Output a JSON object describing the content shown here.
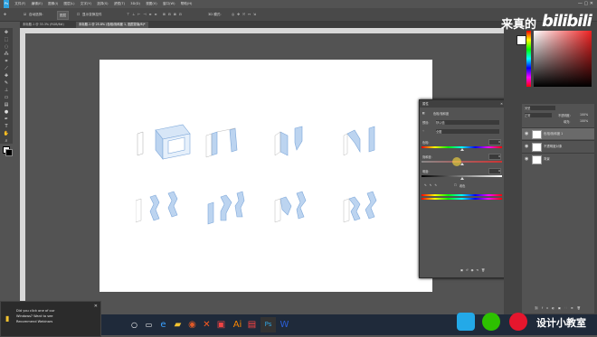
{
  "menubar": {
    "items": [
      "文件(F)",
      "编辑(E)",
      "图像(I)",
      "图层(L)",
      "文字(Y)",
      "选择(S)",
      "滤镜(T)",
      "3D(D)",
      "视图(V)",
      "窗口(W)",
      "帮助(H)"
    ],
    "window_controls": "— ▢ ✕"
  },
  "options": {
    "auto_select": "自动选择:",
    "layer_mode": "图层",
    "show_transform": "显示变换控件",
    "mode_3d": "3D 模式:"
  },
  "tabs": [
    {
      "label": "未标题-1 @ 33.3% (RGB/8#)"
    },
    {
      "label": "未标题-1 @ 25.8% (色相/饱和度 1, 图层蒙版/8)*"
    }
  ],
  "zoom": "33.33%",
  "brand": {
    "prefix": "来真的",
    "logo": "bilibili"
  },
  "dialog": {
    "title": "属性",
    "subtitle": "色相/饱和度",
    "preset_label": "预设:",
    "preset_value": "默认值",
    "channel": "全图",
    "hue_label": "色相:",
    "hue_value": "0",
    "sat_label": "饱和度:",
    "sat_value": "0",
    "light_label": "明度:",
    "light_value": "0",
    "colorize": "着色"
  },
  "layers_panel": {
    "search": "类型",
    "mode": "正常",
    "opacity_label": "不透明度:",
    "opacity": "100%",
    "fill_label": "填充:",
    "fill": "100%",
    "layers": [
      {
        "name": "色相/饱和度 1"
      },
      {
        "name": "不透明度对象"
      },
      {
        "name": "背景"
      }
    ]
  },
  "notification": {
    "line1": "Did you click one of our",
    "line2": "Windows? Want to see",
    "line3": "Recommend Webinars",
    "close": "✕"
  },
  "watermark": {
    "text": "设计小教室"
  },
  "colors": {
    "panel": "#535353",
    "accent_blue": "#bcd4f0",
    "stroke_blue": "#7da7d9"
  },
  "toolbar_icons": [
    "move-icon",
    "marquee-icon",
    "lasso-icon",
    "wand-icon",
    "crop-icon",
    "eyedropper-icon",
    "heal-icon",
    "brush-icon",
    "stamp-icon",
    "history-brush-icon",
    "eraser-icon",
    "gradient-icon",
    "blur-icon",
    "dodge-icon",
    "pen-icon",
    "type-icon",
    "path-select-icon",
    "shape-icon",
    "hand-icon",
    "zoom-icon"
  ]
}
